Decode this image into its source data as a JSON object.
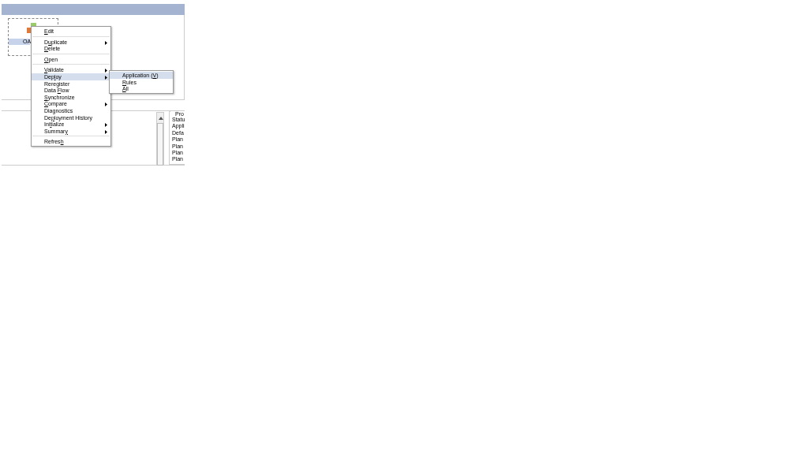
{
  "canvas": {
    "node": {
      "label": "OA",
      "selected": true
    }
  },
  "context_menu": {
    "items": [
      {
        "kind": "item",
        "parts": {
          "key": "E",
          "post": "dit"
        },
        "submenu": false,
        "selected": false
      },
      {
        "kind": "separator"
      },
      {
        "kind": "item",
        "parts": {
          "pre": "D",
          "key": "u",
          "post": "plicate"
        },
        "submenu": true,
        "selected": false
      },
      {
        "kind": "item",
        "parts": {
          "key": "D",
          "post": "elete"
        },
        "submenu": false,
        "selected": false
      },
      {
        "kind": "separator"
      },
      {
        "kind": "item",
        "parts": {
          "key": "O",
          "post": "pen"
        },
        "submenu": false,
        "selected": false
      },
      {
        "kind": "separator"
      },
      {
        "kind": "item",
        "parts": {
          "key": "V",
          "post": "alidate"
        },
        "submenu": true,
        "selected": false
      },
      {
        "kind": "item",
        "parts": {
          "pre": "Dep",
          "key": "l",
          "post": "oy"
        },
        "submenu": true,
        "selected": true
      },
      {
        "kind": "item",
        "text": "Reregister",
        "submenu": false,
        "selected": false
      },
      {
        "kind": "item",
        "parts": {
          "pre": "Data ",
          "key": "F",
          "post": "low"
        },
        "submenu": false,
        "selected": false
      },
      {
        "kind": "item",
        "parts": {
          "key": "S",
          "post": "ynchronize"
        },
        "submenu": false,
        "selected": false
      },
      {
        "kind": "item",
        "parts": {
          "key": "C",
          "post": "ompare"
        },
        "submenu": true,
        "selected": false
      },
      {
        "kind": "item",
        "text": "Diagnostics",
        "submenu": false,
        "selected": false
      },
      {
        "kind": "item",
        "parts": {
          "pre": "De",
          "key": "p",
          "post": "loyment History"
        },
        "submenu": false,
        "selected": false
      },
      {
        "kind": "item",
        "parts": {
          "pre": "Ini",
          "key": "t",
          "post": "ialize"
        },
        "submenu": true,
        "selected": false
      },
      {
        "kind": "item",
        "parts": {
          "pre": "Summar",
          "key": "y"
        },
        "submenu": true,
        "selected": false
      },
      {
        "kind": "separator"
      },
      {
        "kind": "item",
        "parts": {
          "pre": "Refres",
          "key": "h"
        },
        "submenu": false,
        "selected": false
      }
    ]
  },
  "submenu": {
    "items": [
      {
        "kind": "item",
        "parts": {
          "pre": "Application (",
          "key": "V",
          "post": ")"
        },
        "submenu": false,
        "selected": true
      },
      {
        "kind": "item",
        "parts": {
          "key": "R",
          "post": "ules"
        },
        "submenu": false,
        "selected": false
      },
      {
        "kind": "item",
        "parts": {
          "key": "A",
          "post": "ll"
        },
        "submenu": false,
        "selected": false
      }
    ]
  },
  "properties_panel": {
    "title": "Pro",
    "rows": [
      "Statu",
      "Appli",
      "Defa",
      "Plan",
      "Plan",
      "Plan",
      "Plan"
    ]
  }
}
